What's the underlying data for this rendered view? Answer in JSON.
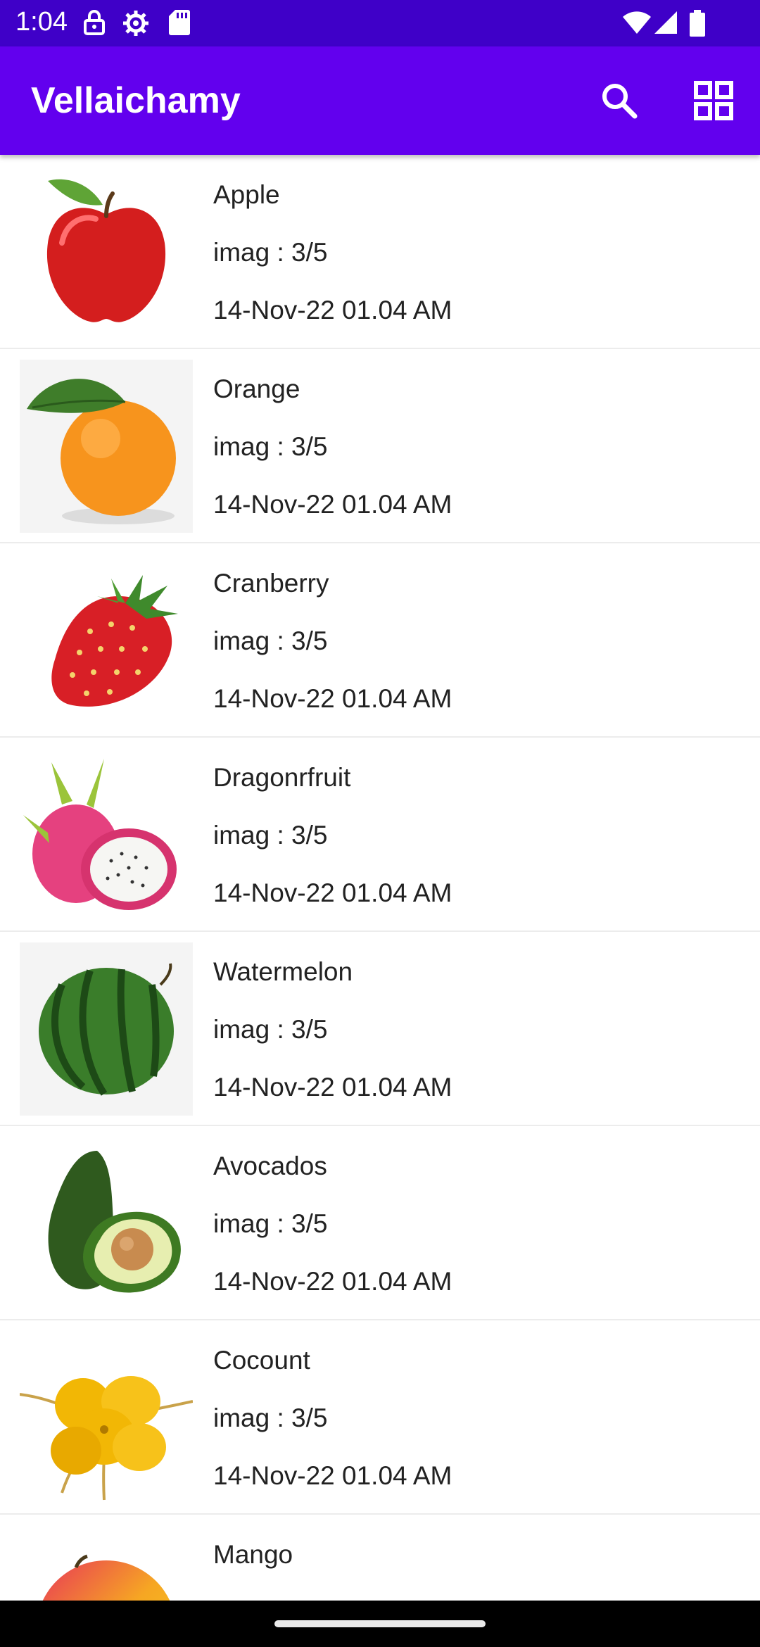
{
  "status_bar": {
    "time": "1:04",
    "left_icons": [
      "lock-icon",
      "gear-icon",
      "sd-card-icon"
    ],
    "right_icons": [
      "wifi-icon",
      "signal-icon",
      "battery-icon"
    ]
  },
  "app_bar": {
    "title": "Vellaichamy",
    "actions": [
      "search-icon",
      "grid-view-icon"
    ],
    "color": "#6200ee"
  },
  "items": [
    {
      "name": "Apple",
      "info": "imag : 3/5",
      "date": "14-Nov-22 01.04 AM"
    },
    {
      "name": "Orange",
      "info": "imag : 3/5",
      "date": "14-Nov-22 01.04 AM"
    },
    {
      "name": "Cranberry",
      "info": "imag : 3/5",
      "date": "14-Nov-22 01.04 AM"
    },
    {
      "name": "Dragonrfruit",
      "info": "imag : 3/5",
      "date": "14-Nov-22 01.04 AM"
    },
    {
      "name": "Watermelon",
      "info": "imag : 3/5",
      "date": "14-Nov-22 01.04 AM"
    },
    {
      "name": "Avocados",
      "info": "imag : 3/5",
      "date": "14-Nov-22 01.04 AM"
    },
    {
      "name": "Cocount",
      "info": "imag : 3/5",
      "date": "14-Nov-22 01.04 AM"
    },
    {
      "name": "Mango"
    }
  ]
}
